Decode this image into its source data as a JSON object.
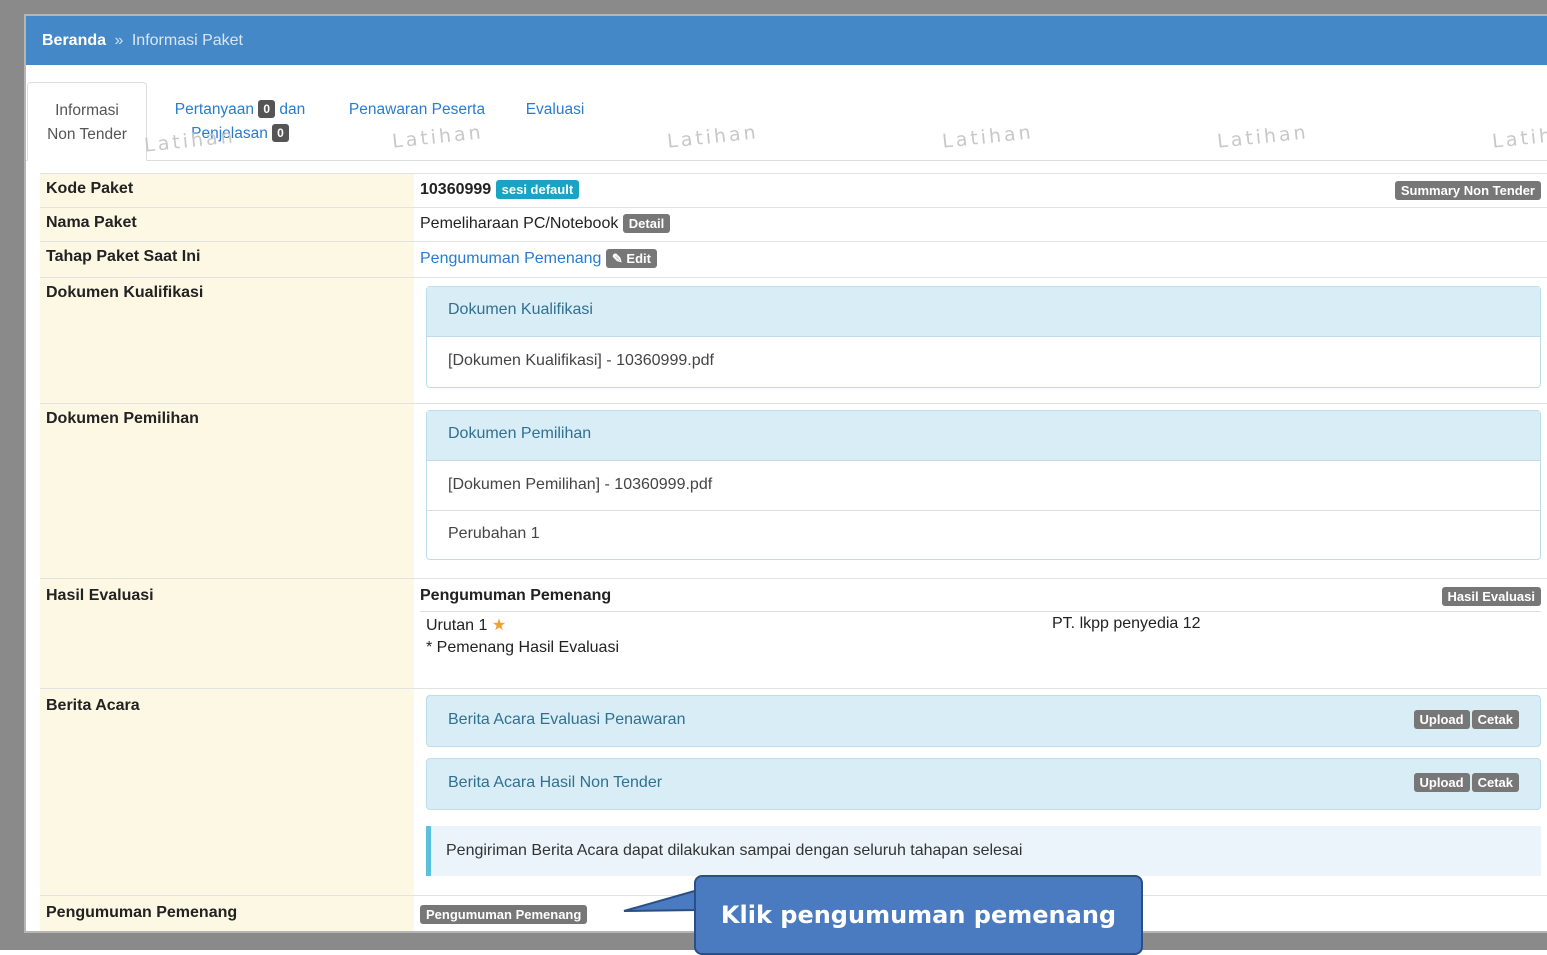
{
  "breadcrumb": {
    "home": "Beranda",
    "separator": "»",
    "current": "Informasi Paket"
  },
  "tabs": [
    {
      "line1": "Informasi",
      "line2": "Non Tender"
    },
    {
      "label_a": "Pertanyaan",
      "count_a": "0",
      "joiner": "dan",
      "label_b": "Penjelasan",
      "count_b": "0"
    },
    {
      "label": "Penawaran Peserta"
    },
    {
      "label": "Evaluasi"
    }
  ],
  "watermark": "Latihan",
  "kode_paket": {
    "label": "Kode Paket",
    "value": "10360999",
    "badge": "sesi default",
    "summary_button": "Summary Non Tender"
  },
  "nama_paket": {
    "label": "Nama Paket",
    "value": "Pemeliharaan PC/Notebook",
    "detail_button": "Detail"
  },
  "tahap": {
    "label": "Tahap Paket Saat Ini",
    "value": "Pengumuman Pemenang",
    "edit_button": "✎ Edit"
  },
  "dok_kualifikasi": {
    "label": "Dokumen Kualifikasi",
    "panel_title": "Dokumen Kualifikasi",
    "items": [
      "[Dokumen Kualifikasi] - 10360999.pdf"
    ]
  },
  "dok_pemilihan": {
    "label": "Dokumen Pemilihan",
    "panel_title": "Dokumen Pemilihan",
    "items": [
      "[Dokumen Pemilihan] - 10360999.pdf",
      "Perubahan 1"
    ]
  },
  "hasil_evaluasi": {
    "label": "Hasil Evaluasi",
    "title": "Pengumuman Pemenang",
    "button": "Hasil Evaluasi",
    "rank": "Urutan 1",
    "note": "* Pemenang Hasil Evaluasi",
    "winner": "PT. lkpp penyedia 12"
  },
  "berita_acara": {
    "label": "Berita Acara",
    "items": [
      {
        "title": "Berita Acara Evaluasi Penawaran",
        "upload": "Upload",
        "cetak": "Cetak"
      },
      {
        "title": "Berita Acara Hasil Non Tender",
        "upload": "Upload",
        "cetak": "Cetak"
      }
    ],
    "notice": "Pengiriman Berita Acara dapat dilakukan sampai dengan seluruh tahapan selesai"
  },
  "pengumuman": {
    "label": "Pengumuman Pemenang",
    "button": "Pengumuman Pemenang"
  },
  "callout": {
    "text": "Klik pengumuman pemenang"
  },
  "colors": {
    "header": "#4488c8",
    "label_bg": "#fcf8e3",
    "panel_bg": "#d9edf7",
    "callout": "#4a7bc0"
  }
}
